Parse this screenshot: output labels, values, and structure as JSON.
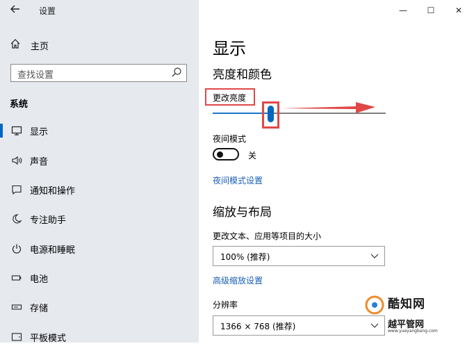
{
  "window": {
    "title": "设置",
    "controls": {
      "minimize": "—",
      "maximize": "☐",
      "close": "✕"
    }
  },
  "sidebar": {
    "home_label": "主页",
    "search_placeholder": "查找设置",
    "section_title": "系统",
    "items": [
      {
        "label": "显示",
        "icon": "monitor-icon",
        "active": true
      },
      {
        "label": "声音",
        "icon": "speaker-icon",
        "active": false
      },
      {
        "label": "通知和操作",
        "icon": "notification-icon",
        "active": false
      },
      {
        "label": "专注助手",
        "icon": "moon-icon",
        "active": false
      },
      {
        "label": "电源和睡眠",
        "icon": "power-icon",
        "active": false
      },
      {
        "label": "电池",
        "icon": "battery-icon",
        "active": false
      },
      {
        "label": "存储",
        "icon": "storage-icon",
        "active": false
      },
      {
        "label": "平板模式",
        "icon": "tablet-icon",
        "active": false
      }
    ]
  },
  "main": {
    "page_title": "显示",
    "brightness_section": "亮度和颜色",
    "brightness_label": "更改亮度",
    "brightness_value": 0.31,
    "night_mode_label": "夜间模式",
    "night_mode_state": "关",
    "night_mode_link": "夜间模式设置",
    "scale_section": "缩放与布局",
    "scale_label": "更改文本、应用等项目的大小",
    "scale_value": "100% (推荐)",
    "advanced_scale_link": "高级缩放设置",
    "resolution_label": "分辨率",
    "resolution_value": "1366 × 768 (推荐)"
  },
  "watermark": {
    "name_top": "酷知网",
    "name_bottom": "越平管网",
    "url": "www.yueyangbang.com"
  },
  "colors": {
    "accent": "#0067c0",
    "annotation": "#e04848",
    "sidebar_bg": "#e6e9ee"
  }
}
